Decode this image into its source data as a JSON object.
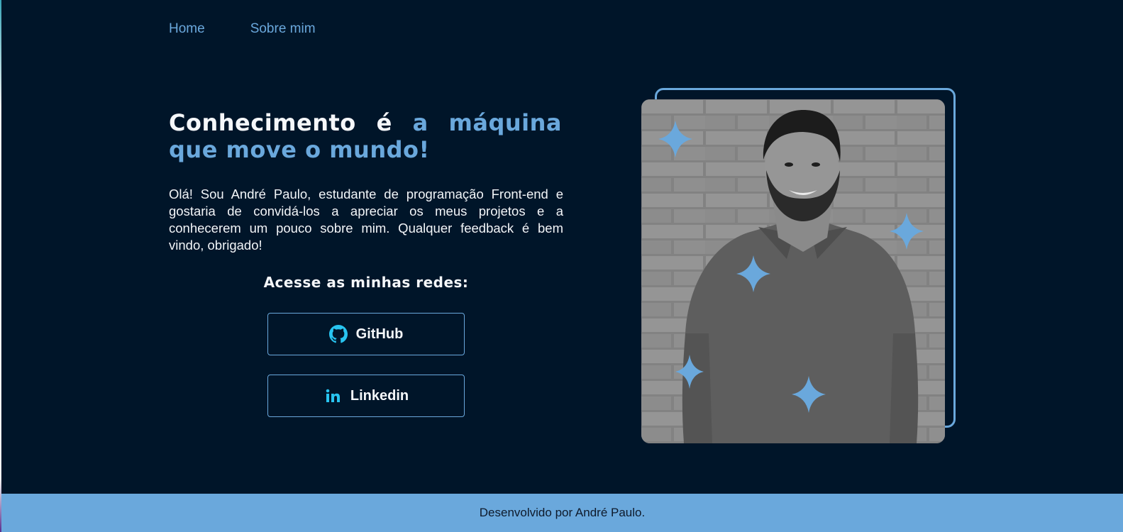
{
  "nav": {
    "home": "Home",
    "about": "Sobre mim"
  },
  "hero": {
    "title_part1": "Conhecimento é ",
    "title_accent": "a máquina que move o mundo!",
    "intro": "Olá! Sou André Paulo, estudante de programação Front-end e gostaria de convidá-los a apreciar os meus projetos e a conhecerem um pouco sobre mim. Qualquer feedback é bem vindo, obrigado!"
  },
  "social": {
    "heading": "Acesse as minhas redes:",
    "buttons": [
      {
        "label": "GitHub",
        "icon": "github-icon"
      },
      {
        "label": "Linkedin",
        "icon": "linkedin-icon"
      }
    ]
  },
  "footer": {
    "text": "Desenvolvido por André Paulo."
  },
  "colors": {
    "background": "#001529",
    "accent": "#6aa8dc",
    "icon_accent": "#28c4f0",
    "footer": "#6aa8dc"
  }
}
